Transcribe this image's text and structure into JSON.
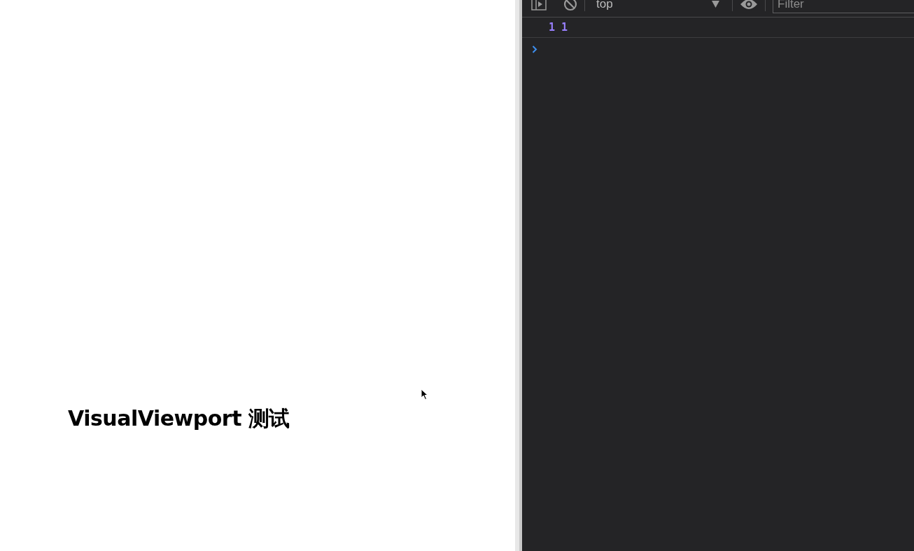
{
  "page": {
    "heading": "VisualViewport 测试"
  },
  "devtools": {
    "toolbar": {
      "context": "top",
      "filter": {
        "placeholder": "Filter"
      }
    },
    "console": {
      "messages": [
        {
          "kind": "log",
          "text": "1 1"
        }
      ]
    }
  }
}
